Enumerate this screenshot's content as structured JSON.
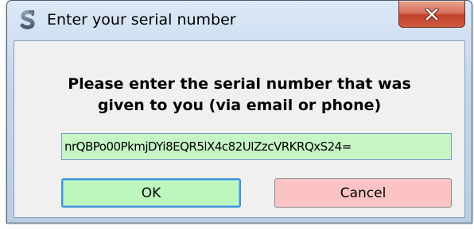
{
  "window": {
    "title": "Enter your serial number",
    "app_icon": "s-logo-icon",
    "close_icon": "close-x-icon"
  },
  "dialog": {
    "prompt": "Please enter the serial number that was given to you (via email or phone)",
    "serial_value": "nrQBPo00PkmjDYi8EQR5lX4c82UIZzcVRKRQxS24=",
    "ok_label": "OK",
    "cancel_label": "Cancel"
  },
  "colors": {
    "input_bg": "#c6f5c6",
    "ok_bg": "#bdf7bd",
    "cancel_bg": "#fbc3c3",
    "close_btn": "#c2432c"
  }
}
